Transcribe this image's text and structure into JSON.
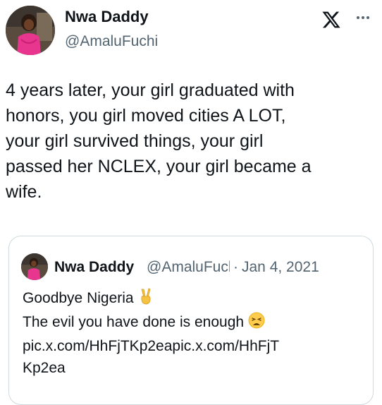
{
  "author": {
    "display_name": "Nwa Daddy",
    "handle": "@AmaluFuchi"
  },
  "header": {
    "logo_icon": "x-logo-icon",
    "more_icon": "more-options-icon"
  },
  "tweet": {
    "text": "4 years later, your girl graduated with\nhonors, you girl moved cities A LOT,\nyour girl survived things, your girl\npassed her NCLEX, your girl became a\nwife."
  },
  "quoted_tweet": {
    "display_name": "Nwa Daddy",
    "handle": "@AmaluFuchi",
    "separator": "·",
    "date": "Jan 4, 2021",
    "line1": "Goodbye Nigeria",
    "line1_emoji": "victory-hand-emoji",
    "line2": "The evil you have done is enough",
    "line2_emoji": "weary-face-emoji",
    "link": "pic.x.com/HhFjTKp2eapic.x.com/HhFjT",
    "link_tail": "Kp2ea"
  },
  "colors": {
    "text": "#0f1419",
    "secondary": "#536471",
    "border": "#cfd9de",
    "avatar_outfit": "#e8368f"
  }
}
